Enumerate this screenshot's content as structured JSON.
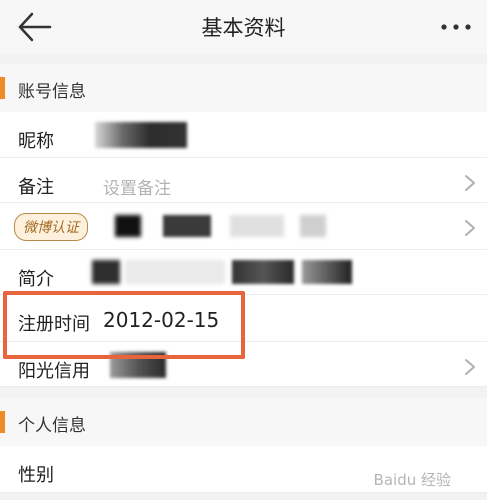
{
  "header": {
    "title": "基本资料"
  },
  "sections": {
    "account": {
      "title": "账号信息"
    },
    "personal": {
      "title": "个人信息"
    }
  },
  "rows": {
    "nickname": {
      "label": "昵称"
    },
    "remark": {
      "label": "备注",
      "placeholder": "设置备注"
    },
    "weibo_verify": {
      "badge": "微博认证"
    },
    "bio": {
      "label": "简介"
    },
    "register_time": {
      "label": "注册时间",
      "value": "2012-02-15"
    },
    "sunshine_credit": {
      "label": "阳光信用"
    },
    "gender": {
      "label": "性别"
    }
  },
  "watermark": "Baidu 经验",
  "colors": {
    "accent": "#f08a24",
    "highlight": "#e8643a",
    "badge_bg": "#fdf1dd"
  },
  "icons": {
    "back": "back-arrow-icon",
    "more": "more-dots-icon",
    "chevron": "chevron-right-icon"
  }
}
